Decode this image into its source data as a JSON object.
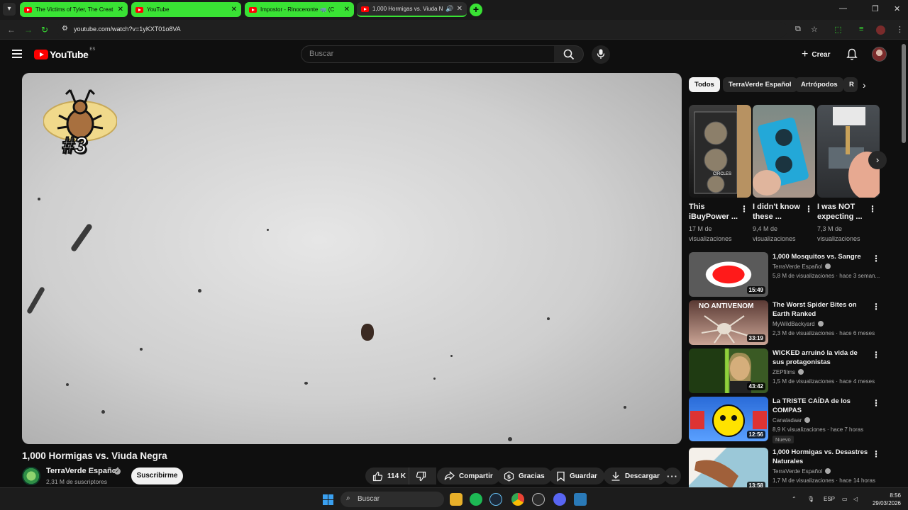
{
  "browser": {
    "tabs": [
      {
        "title": "The Victims of Tyler, The Creat",
        "style": "green"
      },
      {
        "title": "YouTube",
        "style": "green"
      },
      {
        "title": "Impostor - Rinoceronte 🦏 (C",
        "style": "green"
      },
      {
        "title": "1,000 Hormigas vs. Viuda N",
        "style": "active"
      }
    ],
    "url": "youtube.com/watch?v=1yKXT01o8VA",
    "accent": "#39e234"
  },
  "header": {
    "logo_text": "YouTube",
    "country_code": "ES",
    "search_placeholder": "Buscar",
    "create_label": "Crear"
  },
  "player": {
    "overlay_text": "#3"
  },
  "video": {
    "title": "1,000 Hormigas vs. Viuda Negra",
    "channel": "TerraVerde Español",
    "subscribers": "2,31 M de suscriptores",
    "subscribe_label": "Suscribirme",
    "likes": "114 K",
    "share_label": "Compartir",
    "thanks_label": "Gracias",
    "save_label": "Guardar",
    "download_label": "Descargar"
  },
  "chips": [
    "Todos",
    "TerraVerde Español",
    "Artrópodos",
    "R"
  ],
  "shorts": [
    {
      "title": "This iBuyPower ...",
      "views": "17 M de visualizaciones"
    },
    {
      "title": "I didn't know these ...",
      "views": "9,4 M de visualizaciones"
    },
    {
      "title": "I was NOT expecting ...",
      "views": "7,3 M de visualizaciones"
    }
  ],
  "shorts_overlay_text": "CIRCLES",
  "recommendations": [
    {
      "title": "1,000 Mosquitos vs. Sangre",
      "channel": "TerraVerde Español",
      "meta": "5,8 M de visualizaciones · hace 3 seman...",
      "duration": "15:49",
      "badge": ""
    },
    {
      "title": "The Worst Spider Bites on Earth Ranked",
      "channel": "MyWildBackyard",
      "meta": "2,3 M de visualizaciones · hace 6 meses",
      "duration": "33:19",
      "badge": "",
      "thumb_text": "NO ANTIVENOM"
    },
    {
      "title": "WICKED arruinó la vida de sus protagonistas",
      "channel": "ZEPfilms",
      "meta": "1,5 M de visualizaciones · hace 4 meses",
      "duration": "43:42",
      "badge": ""
    },
    {
      "title": "La TRISTE CAÍDA de los COMPAS",
      "channel": "Canaladaar",
      "meta": "8,9 K visualizaciones · hace 7 horas",
      "duration": "12:56",
      "badge": "Nuevo"
    },
    {
      "title": "1,000 Hormigas vs. Desastres Naturales",
      "channel": "TerraVerde Español",
      "meta": "1,7 M de visualizaciones · hace 14 horas",
      "duration": "13:58",
      "badge": ""
    }
  ],
  "taskbar": {
    "search_placeholder": "Buscar",
    "language": "ESP",
    "time": "8:56",
    "date": "29/03/2026"
  }
}
